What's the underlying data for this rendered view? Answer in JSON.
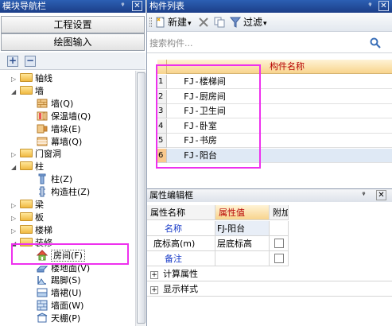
{
  "left_panel": {
    "title": "模块导航栏",
    "pin": "ᵠ",
    "close": "✕",
    "buttons": [
      "工程设置",
      "绘图输入"
    ],
    "toolbar": {
      "expand": "+",
      "collapse": "−"
    },
    "tree": [
      {
        "label": "轴线",
        "toggle": "▷",
        "level": 0,
        "icon": "folder-icon"
      },
      {
        "label": "墙",
        "toggle": "◢",
        "level": 0,
        "icon": "folder-icon"
      },
      {
        "label": "墙(Q)",
        "level": 1,
        "icon": "wall-icon"
      },
      {
        "label": "保温墙(Q)",
        "level": 1,
        "icon": "insulation-wall-icon"
      },
      {
        "label": "墙垛(E)",
        "level": 1,
        "icon": "wall-pier-icon"
      },
      {
        "label": "幕墙(Q)",
        "level": 1,
        "icon": "curtain-wall-icon"
      },
      {
        "label": "门窗洞",
        "toggle": "▷",
        "level": 0,
        "icon": "folder-icon"
      },
      {
        "label": "柱",
        "toggle": "◢",
        "level": 0,
        "icon": "folder-icon"
      },
      {
        "label": "柱(Z)",
        "level": 1,
        "icon": "column-icon"
      },
      {
        "label": "构造柱(Z)",
        "level": 1,
        "icon": "structural-column-icon"
      },
      {
        "label": "梁",
        "toggle": "▷",
        "level": 0,
        "icon": "folder-icon"
      },
      {
        "label": "板",
        "toggle": "▷",
        "level": 0,
        "icon": "folder-icon"
      },
      {
        "label": "楼梯",
        "toggle": "▷",
        "level": 0,
        "icon": "folder-icon"
      },
      {
        "label": "装修",
        "toggle": "◢",
        "level": 0,
        "icon": "folder-icon"
      },
      {
        "label": "房间(F)",
        "level": 1,
        "icon": "room-icon",
        "selected": true
      },
      {
        "label": "楼地面(V)",
        "level": 1,
        "icon": "floor-icon"
      },
      {
        "label": "踢脚(S)",
        "level": 1,
        "icon": "skirting-icon"
      },
      {
        "label": "墙裙(U)",
        "level": 1,
        "icon": "dado-icon"
      },
      {
        "label": "墙面(W)",
        "level": 1,
        "icon": "wall-surface-icon"
      },
      {
        "label": "天棚(P)",
        "level": 1,
        "icon": "ceiling-icon"
      }
    ]
  },
  "component_panel": {
    "title": "构件列表",
    "pin": "ᵠ",
    "close": "✕",
    "toolbar": {
      "new_label": "新建",
      "filter_label": "过滤",
      "dropdown": "▾"
    },
    "search_placeholder": "搜索构件...",
    "column_header": "构件名称",
    "rows": [
      {
        "num": "1",
        "name": "FJ-楼梯间"
      },
      {
        "num": "2",
        "name": "FJ-厨房间"
      },
      {
        "num": "3",
        "name": "FJ-卫生间"
      },
      {
        "num": "4",
        "name": "FJ-卧室"
      },
      {
        "num": "5",
        "name": "FJ-书房"
      },
      {
        "num": "6",
        "name": "FJ-阳台",
        "selected": true
      }
    ]
  },
  "property_panel": {
    "title": "属性编辑框",
    "pin": "ᵠ",
    "close": "✕",
    "headers": [
      "属性名称",
      "属性值",
      "附加"
    ],
    "rows": [
      {
        "name": "名称",
        "value": "FJ-阳台",
        "name_color": "#1a3cc8",
        "checkbox": false
      },
      {
        "name": "底标高(m)",
        "value": "层底标高",
        "name_color": "#000000",
        "checkbox": true
      },
      {
        "name": "备注",
        "value": "",
        "name_color": "#1a3cc8",
        "checkbox": true
      },
      {
        "name": "计算属性",
        "value": "",
        "expandable": true
      },
      {
        "name": "显示样式",
        "value": "",
        "expandable": true
      }
    ],
    "expand_glyph": "+"
  },
  "colors": {
    "title_bar": "#1c3e88",
    "highlight": "#ee31ee",
    "header_text": "#b60000",
    "link_blue": "#1a3cc8"
  }
}
